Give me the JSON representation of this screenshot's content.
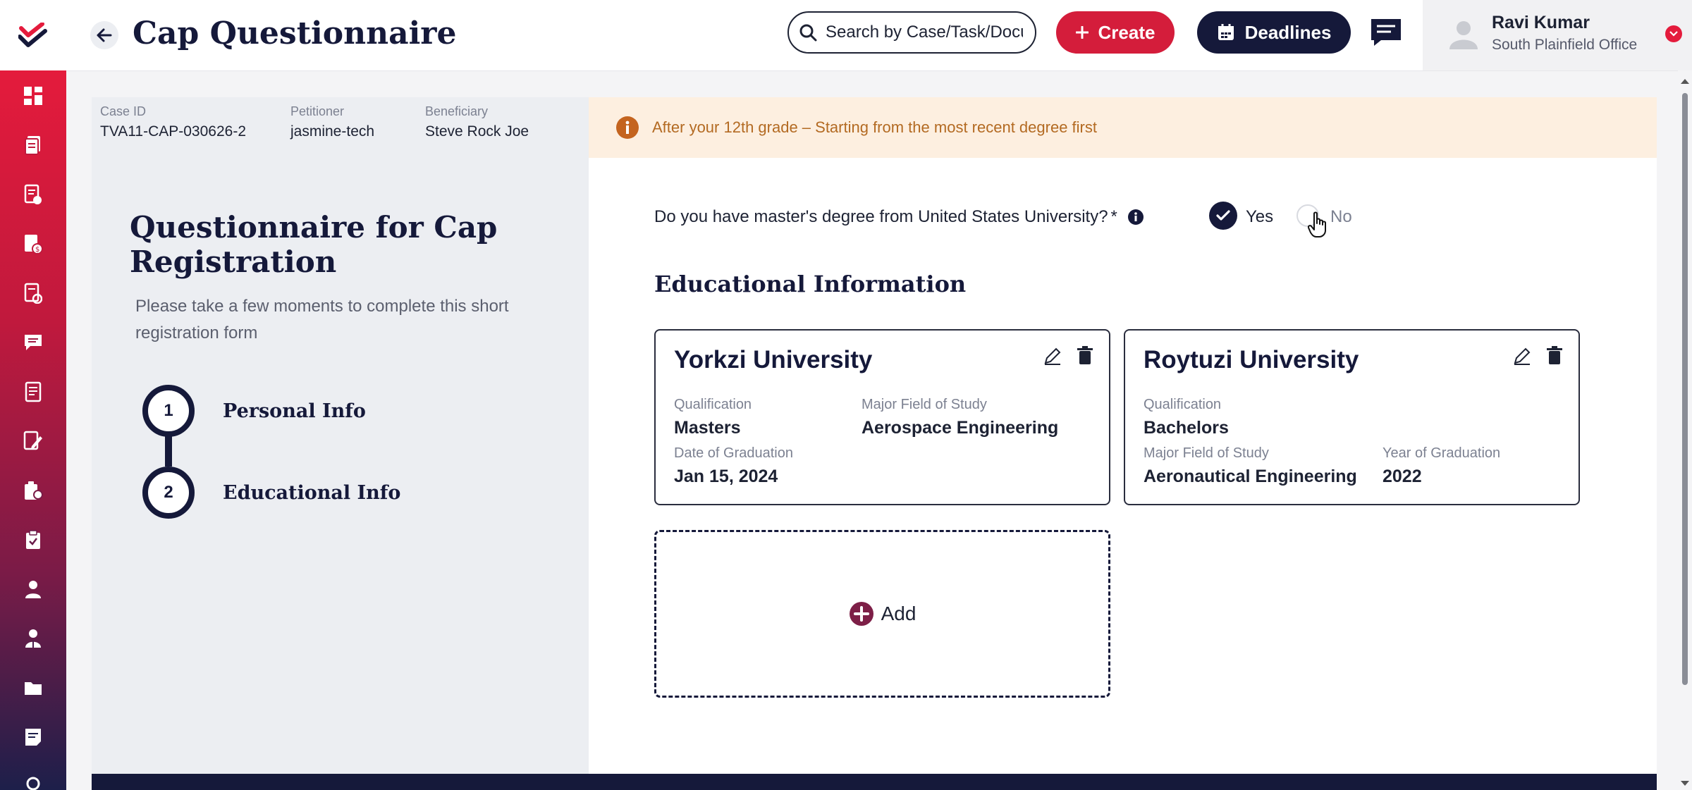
{
  "header": {
    "title": "Cap Questionnaire",
    "search_placeholder": "Search by Case/Task/Document",
    "create_label": "Create",
    "deadlines_label": "Deadlines"
  },
  "user": {
    "name": "Ravi Kumar",
    "office": "South Plainfield Office"
  },
  "sidebar": {
    "icons": [
      "dashboard-icon",
      "cases-icon",
      "documents-icon",
      "invoice-icon",
      "tasks-icon",
      "messages-icon",
      "reports-icon",
      "forms-icon",
      "clients-icon",
      "checklist-icon",
      "user-icon",
      "team-icon",
      "folder-icon",
      "notes-icon"
    ]
  },
  "case_info": {
    "case_id_label": "Case ID",
    "case_id": "TVA11-CAP-030626-2",
    "petitioner_label": "Petitioner",
    "petitioner": "jasmine-tech",
    "beneficiary_label": "Beneficiary",
    "beneficiary": "Steve Rock Joe"
  },
  "notice": "After your 12th grade – Starting from the most recent degree first",
  "left_panel": {
    "title": "Questionnaire for Cap Registration",
    "subtitle": "Please take a few moments to complete this short registration form",
    "steps": [
      {
        "number": "1",
        "label": "Personal Info"
      },
      {
        "number": "2",
        "label": "Educational Info"
      }
    ]
  },
  "question": {
    "text": "Do you have master's degree from United States University?",
    "required_mark": "*",
    "yes_label": "Yes",
    "no_label": "No",
    "selected": "Yes"
  },
  "education": {
    "title": "Educational Information",
    "cards": [
      {
        "university": "Yorkzi University",
        "qualification_label": "Qualification",
        "qualification": "Masters",
        "major_label": "Major Field of Study",
        "major": "Aerospace Engineering",
        "date_label": "Date of Graduation",
        "date": "Jan 15, 2024"
      },
      {
        "university": "Roytuzi University",
        "qualification_label": "Qualification",
        "qualification": "Bachelors",
        "major_label": "Major Field of Study",
        "major": "Aeronautical Engineering",
        "year_label": "Year of Graduation",
        "year": "2022"
      }
    ],
    "add_label": "Add"
  },
  "colors": {
    "navy": "#15193a",
    "brand_red": "#e41b3c",
    "notice_bg": "#fdefe0",
    "notice_text": "#b36a22"
  }
}
